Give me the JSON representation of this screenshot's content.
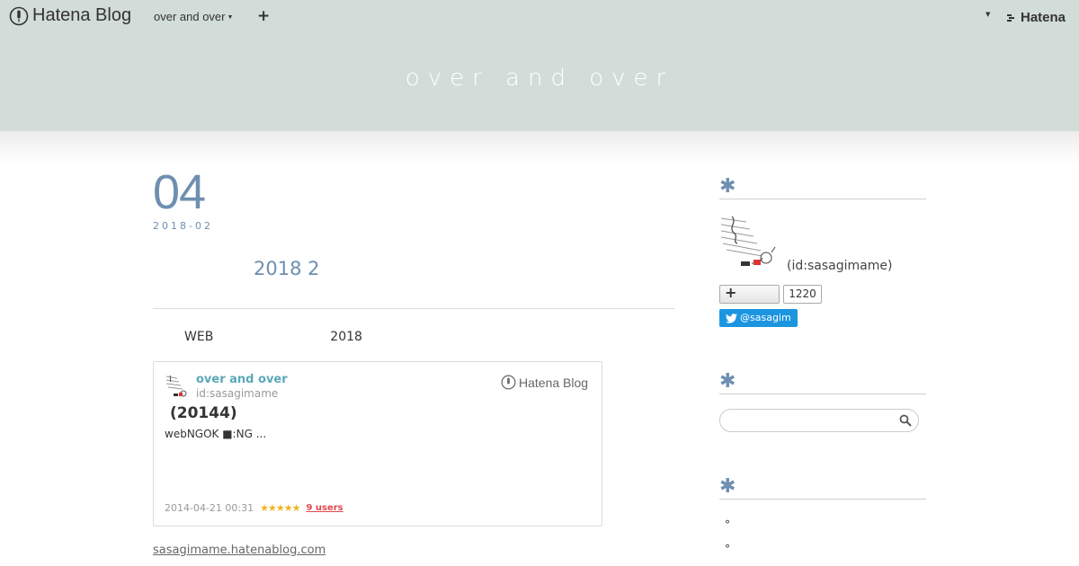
{
  "topbar": {
    "brand": "Hatena Blog",
    "blog_menu": "over and over",
    "plus": "+",
    "hatena": "Hatena"
  },
  "header": {
    "title": "over and over"
  },
  "entry": {
    "day": "04",
    "date": "2018-02",
    "title": "2018 2",
    "body_left": "WEB",
    "body_right": "2018",
    "site_link": "sasagimame.hatenablog.com"
  },
  "card": {
    "blog_name": "over and over",
    "user_id": "id:sasagimame",
    "logo": "Hatena Blog",
    "title": "(20144)",
    "excerpt": "webNGOK ■:NG ...",
    "datetime": "2014-04-21 00:31",
    "stars": "★★★★★",
    "users": "9 users"
  },
  "sidebar": {
    "module_mark": "✱",
    "profile_id": "(id:sasagimame)",
    "subscribe_label": "+",
    "subscriber_count": "1220",
    "twitter": "@sasagim",
    "search_placeholder": "",
    "list_bullet": "°"
  },
  "colors": {
    "accent": "#6e8fb0",
    "header_bg": "#d2dcd8",
    "twitter": "#1b95e0",
    "card_name": "#5aa8b8"
  }
}
